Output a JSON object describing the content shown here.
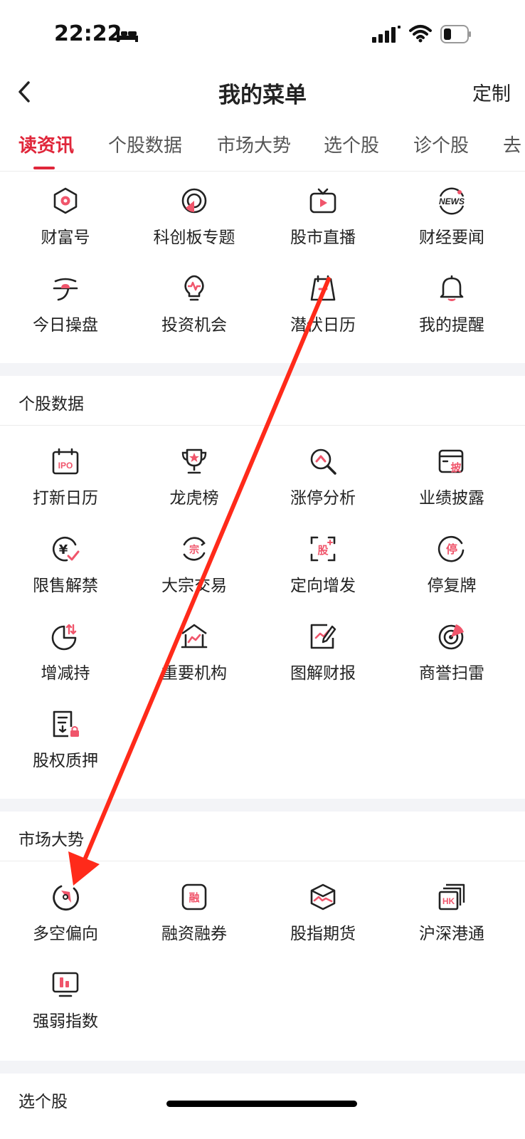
{
  "status_bar": {
    "time": "22:22"
  },
  "nav": {
    "title": "我的菜单",
    "custom_label": "定制"
  },
  "tabs": [
    "读资讯",
    "个股数据",
    "市场大势",
    "选个股",
    "诊个股",
    "去"
  ],
  "sections": {
    "news": {
      "items": [
        {
          "label": "财富号",
          "icon": "hexagon-icon"
        },
        {
          "label": "科创板专题",
          "icon": "ring-icon"
        },
        {
          "label": "股市直播",
          "icon": "tv-icon"
        },
        {
          "label": "财经要闻",
          "icon": "news-icon"
        },
        {
          "label": "今日操盘",
          "icon": "curve-icon"
        },
        {
          "label": "投资机会",
          "icon": "lightbulb-icon"
        },
        {
          "label": "潜伏日历",
          "icon": "calendar-icon"
        },
        {
          "label": "我的提醒",
          "icon": "bell-icon"
        }
      ]
    },
    "stock_data": {
      "title": "个股数据",
      "items": [
        {
          "label": "打新日历",
          "icon": "ipo-calendar-icon",
          "icon_text": "IPO"
        },
        {
          "label": "龙虎榜",
          "icon": "trophy-icon"
        },
        {
          "label": "涨停分析",
          "icon": "magnifier-icon"
        },
        {
          "label": "业绩披露",
          "icon": "disclosure-icon",
          "icon_text": "披"
        },
        {
          "label": "限售解禁",
          "icon": "yen-check-icon",
          "icon_text": "¥"
        },
        {
          "label": "大宗交易",
          "icon": "block-trade-icon",
          "icon_text": "宗"
        },
        {
          "label": "定向增发",
          "icon": "placement-icon",
          "icon_text": "股"
        },
        {
          "label": "停复牌",
          "icon": "suspension-icon",
          "icon_text": "停"
        },
        {
          "label": "增减持",
          "icon": "pie-chart-icon"
        },
        {
          "label": "重要机构",
          "icon": "institution-icon"
        },
        {
          "label": "图解财报",
          "icon": "report-chart-icon"
        },
        {
          "label": "商誉扫雷",
          "icon": "radar-icon"
        },
        {
          "label": "股权质押",
          "icon": "pledge-icon"
        }
      ]
    },
    "market": {
      "title": "市场大势",
      "items": [
        {
          "label": "多空偏向",
          "icon": "compass-icon"
        },
        {
          "label": "融资融券",
          "icon": "margin-icon",
          "icon_text": "融"
        },
        {
          "label": "股指期货",
          "icon": "futures-box-icon"
        },
        {
          "label": "沪深港通",
          "icon": "hk-connect-icon",
          "icon_text": "HK"
        },
        {
          "label": "强弱指数",
          "icon": "strength-index-icon"
        }
      ]
    },
    "pick_stock": {
      "title": "选个股"
    }
  },
  "colors": {
    "accent": "#e0263a",
    "pink": "#f0556b",
    "icon_stroke": "#222222",
    "gap": "#f3f4f7"
  }
}
